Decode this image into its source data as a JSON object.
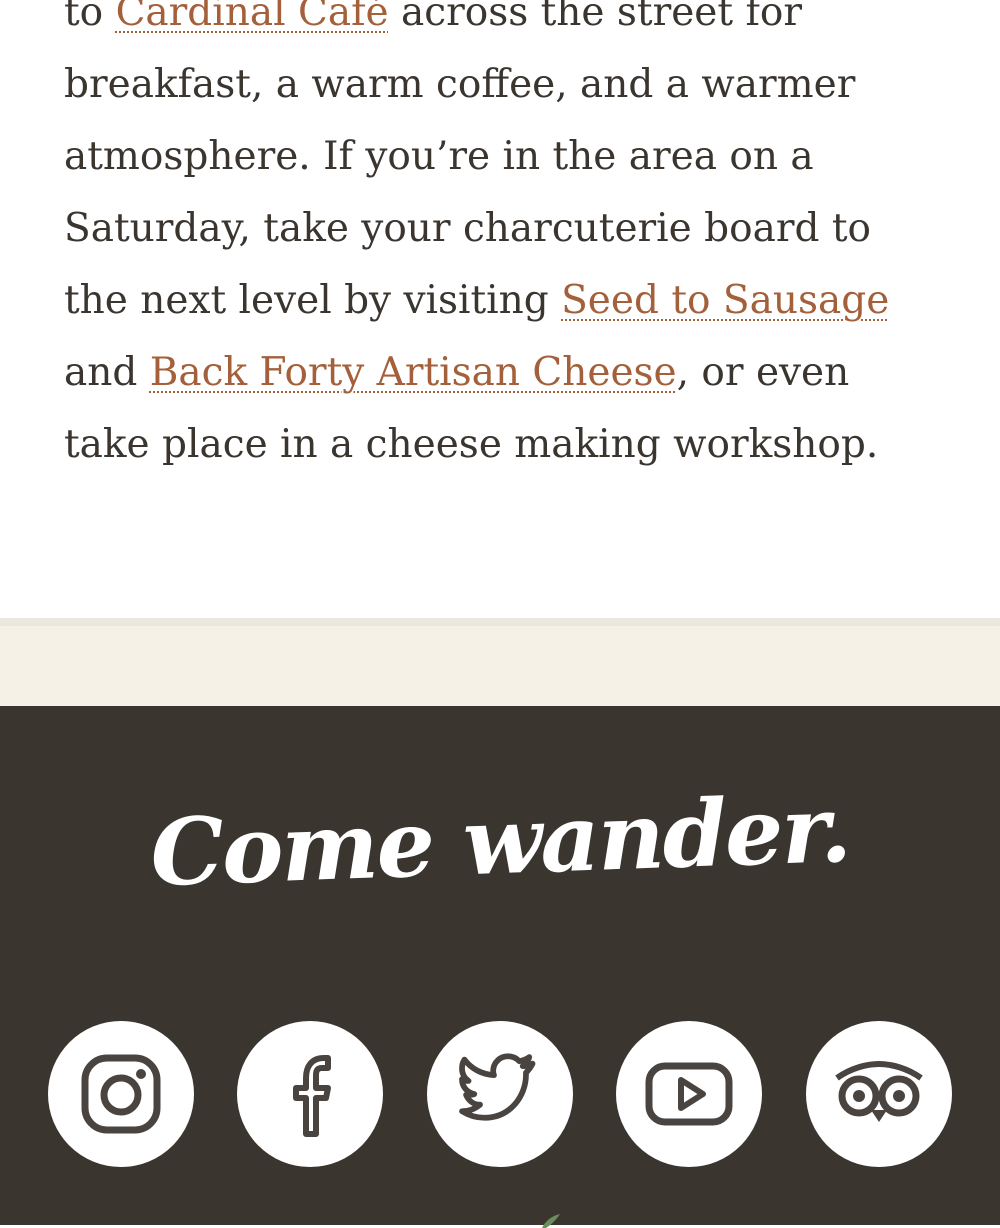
{
  "article": {
    "text_1": "to ",
    "link_cardinal": "Cardinal Café",
    "text_2": " across the street for breakfast, a warm coffee, and a warmer atmosphere. If you’re in the area on a Saturday, take your charcuterie board to the next level by visiting ",
    "link_seed": "Seed to Sausage",
    "text_3": " and ",
    "link_backforty": "Back Forty Artisan Cheese",
    "text_4": ", or even take place in a cheese making workshop."
  },
  "footer": {
    "tagline": "Come wander.",
    "social": [
      {
        "icon": "instagram-icon"
      },
      {
        "icon": "facebook-icon"
      },
      {
        "icon": "twitter-icon"
      },
      {
        "icon": "youtube-icon"
      },
      {
        "icon": "tripadvisor-icon"
      }
    ]
  },
  "colors": {
    "text": "#3b3530",
    "link": "#a4603a",
    "cream": "#f5f1e7",
    "footer_bg": "#3b3530",
    "icon_stroke": "#4a4440"
  }
}
